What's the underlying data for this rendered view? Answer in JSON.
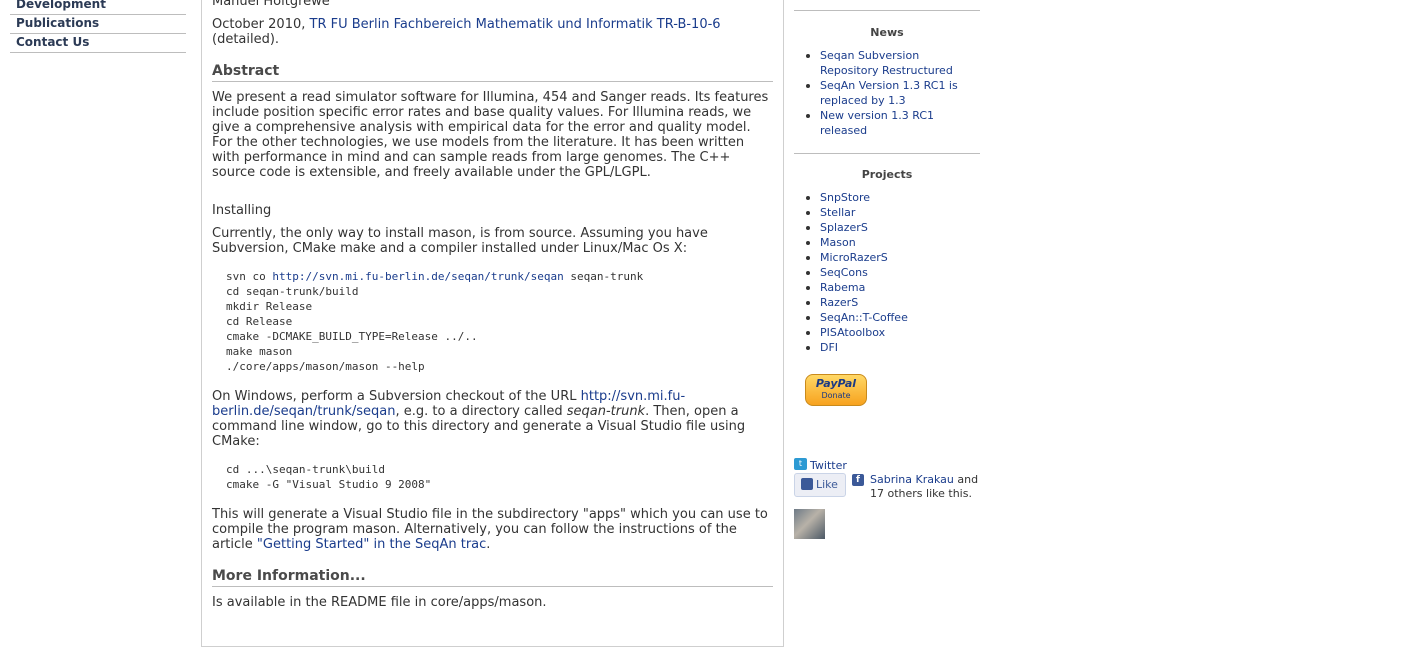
{
  "left_nav": {
    "items": [
      {
        "label": "Development"
      },
      {
        "label": "Publications"
      },
      {
        "label": "Contact Us"
      }
    ]
  },
  "main": {
    "cut_author": "Manuel Holtgrewe",
    "citation": {
      "date": "October 2010,",
      "link": "TR FU Berlin Fachbereich Mathematik und Informatik TR-B-10-6",
      "suffix": "(detailed)."
    },
    "abstract": {
      "heading": "Abstract",
      "body": "We present a read simulator software for Illumina, 454 and Sanger reads. Its features include position specific error rates and base quality values. For Illumina reads, we give a comprehensive analysis with empirical data for the error and quality model. For the other technologies, we use models from the literature. It has been written with performance in mind and can sample reads from large genomes. The C++ source code is extensible, and freely available under the GPL/LGPL."
    },
    "installing": {
      "heading": "Installing",
      "intro": "Currently, the only way to install mason, is from source. Assuming you have Subversion, CMake make and a compiler installed under Linux/Mac Os X:",
      "code_lines": [
        {
          "prefix": "svn co ",
          "link": "http://svn.mi.fu-berlin.de/seqan/trunk/seqan",
          "suffix": " seqan-trunk"
        },
        {
          "prefix": "cd seqan-trunk/build"
        },
        {
          "prefix": "mkdir Release"
        },
        {
          "prefix": "cd Release"
        },
        {
          "prefix": "cmake -DCMAKE_BUILD_TYPE=Release ../.."
        },
        {
          "prefix": "make mason"
        },
        {
          "prefix": "./core/apps/mason/mason --help"
        }
      ],
      "windows_pre": "On Windows, perform a Subversion checkout of the URL",
      "windows_link": "http://svn.mi.fu-berlin.de/seqan/trunk/seqan",
      "windows_mid": ", e.g. to a directory called",
      "windows_em": "seqan-trunk",
      "windows_post": ". Then, open a command line window, go to this directory and generate a Visual Studio file using CMake:",
      "code2_lines": [
        "cd ...\\seqan-trunk\\build",
        "cmake -G \"Visual Studio 9 2008\""
      ],
      "final_pre": "This will generate a Visual Studio file in the subdirectory \"apps\" which you can use to compile the program mason. Alternatively, you can follow the instructions of the article",
      "final_link": "\"Getting Started\" in the SeqAn trac",
      "final_post": "."
    },
    "more_info": {
      "heading": "More Information...",
      "body": "Is available in the README file in core/apps/mason."
    }
  },
  "sidebar": {
    "news": {
      "title": "News",
      "items": [
        "Seqan Subversion Repository Restructured",
        "SeqAn Version 1.3 RC1 is replaced by 1.3",
        "New version 1.3 RC1 released"
      ]
    },
    "projects": {
      "title": "Projects",
      "items": [
        "SnpStore",
        "Stellar",
        "SplazerS",
        "Mason",
        "MicroRazerS",
        "SeqCons",
        "Rabema",
        "RazerS",
        "SeqAn::T-Coffee",
        "PISAtoolbox",
        "DFI"
      ]
    },
    "paypal": {
      "brand": "PayPal",
      "label": "Donate"
    },
    "twitter": {
      "label": "Twitter"
    },
    "facebook": {
      "like_label": "Like",
      "friend": "Sabrina Krakau",
      "rest": "and 17 others like this."
    }
  }
}
